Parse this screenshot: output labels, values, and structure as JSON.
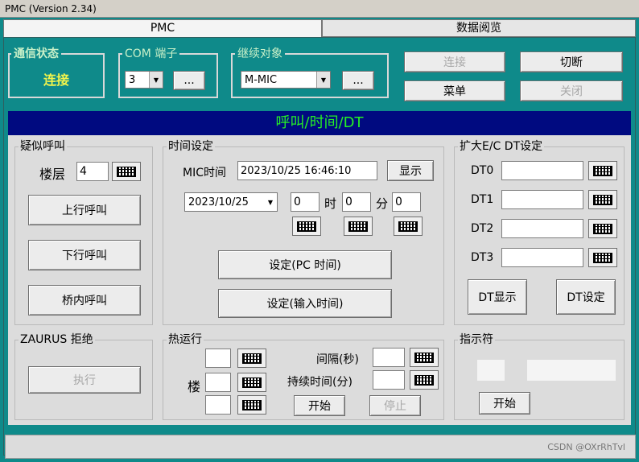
{
  "window": {
    "title": "PMC (Version 2.34)"
  },
  "tabs": [
    {
      "label": "PMC"
    },
    {
      "label": "数据阅览"
    }
  ],
  "top": {
    "status_group": {
      "label": "通信状态",
      "value": "连接"
    },
    "com_group": {
      "label": "COM 端子",
      "port_value": "3",
      "more_label": "..."
    },
    "target_group": {
      "label": "继续对象",
      "value": "M-MIC",
      "more_label": "..."
    },
    "buttons": {
      "connect": "连接",
      "disconnect": "切断",
      "menu": "菜单",
      "close": "关闭"
    }
  },
  "header": {
    "title": "呼叫/时间/DT"
  },
  "pseudo_call": {
    "label": "疑似呼叫",
    "floor_label": "楼层",
    "floor_value": "4",
    "up_call": "上行呼叫",
    "down_call": "下行呼叫",
    "car_call": "桥内呼叫"
  },
  "time_settings": {
    "label": "时间设定",
    "mic_time_label": "MIC时间",
    "mic_time_value": "2023/10/25 16:46:10",
    "display_button": "显示",
    "date_value": "2023/10/25",
    "hour_value": "0",
    "hour_label": "时",
    "minute_value": "0",
    "minute_label": "分",
    "second_value": "0",
    "set_pc_time": "设定(PC 时间)",
    "set_input_time": "设定(输入时间)"
  },
  "dt_settings": {
    "label": "扩大E/C  DT设定",
    "rows": [
      {
        "label": "DT0",
        "value": ""
      },
      {
        "label": "DT1",
        "value": ""
      },
      {
        "label": "DT2",
        "value": ""
      },
      {
        "label": "DT3",
        "value": ""
      }
    ],
    "display_button": "DT显示",
    "set_button": "DT设定"
  },
  "zaurus": {
    "label": "ZAURUS 拒绝",
    "execute_button": "执行"
  },
  "heat_run": {
    "label": "热运行",
    "floor_label": "楼",
    "interval_label": "间隔(秒)",
    "duration_label": "持续时间(分)",
    "start_button": "开始",
    "stop_button": "停止"
  },
  "indicator": {
    "label": "指示符",
    "start_button": "开始"
  },
  "watermark": "CSDN @OXrRhTvl",
  "colors": {
    "background": "#0f8a8a",
    "header_bg": "#000a80",
    "header_text": "#25f025",
    "status_value": "#f2f44c"
  }
}
